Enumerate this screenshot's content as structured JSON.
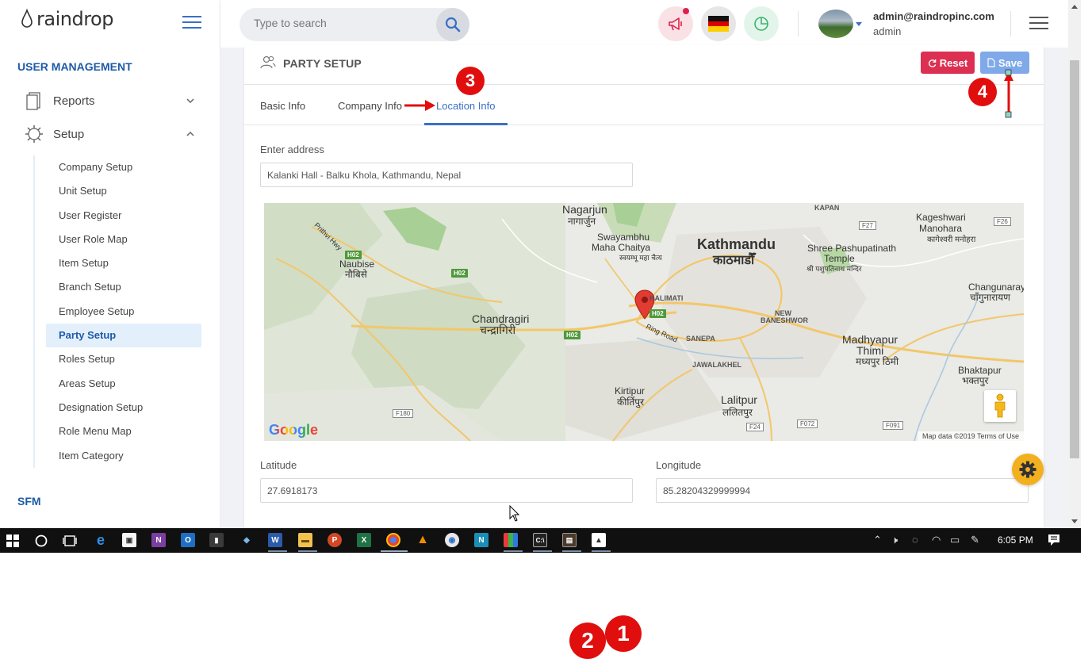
{
  "brand": {
    "name": "raindrop"
  },
  "sidebar": {
    "section_user_management": "USER MANAGEMENT",
    "section_sfm": "SFM",
    "groups": [
      {
        "label": "Reports",
        "expanded": false
      },
      {
        "label": "Setup",
        "expanded": true
      }
    ],
    "setup_items": [
      "Company Setup",
      "Unit Setup",
      "User Register",
      "User Role Map",
      "Item Setup",
      "Branch Setup",
      "Employee Setup",
      "Party Setup",
      "Roles Setup",
      "Areas Setup",
      "Designation Setup",
      "Role Menu Map",
      "Item Category"
    ],
    "active_item": "Party Setup"
  },
  "header": {
    "search_placeholder": "Type to search",
    "user_email": "admin@raindropinc.com",
    "user_role": "admin"
  },
  "page": {
    "title": "PARTY SETUP",
    "reset_label": "Reset",
    "save_label": "Save",
    "tabs": [
      "Basic Info",
      "Company Info",
      "Location Info"
    ],
    "active_tab": "Location Info",
    "address_label": "Enter address",
    "address_value": "Kalanki Hall - Balku Khola, Kathmandu, Nepal",
    "latitude_label": "Latitude",
    "latitude_value": "27.6918173",
    "longitude_label": "Longitude",
    "longitude_value": "85.28204329999994"
  },
  "map": {
    "places": {
      "nagarjun": "Nagarjun",
      "nagarjun_ne": "नागार्जुन",
      "swayambhu": "Swayambhu",
      "maha_chaitya": "Maha Chaitya",
      "swayambhu_ne": "स्वयम्भू महा चैत्य",
      "kathmandu": "Kathmandu",
      "kathmandu_ne": "काठमाडौँ",
      "pashupatinath": "Shree Pashupatinath",
      "temple": "Temple",
      "pashupatinath_ne": "श्री पशुपतिनाथ मन्दिर",
      "kageshwari": "Kageshwari",
      "manohara": "Manohara",
      "kageshwari_ne": "कागेश्वरी मनोहरा",
      "naubise": "Naubise",
      "naubise_ne": "नौबिसे",
      "prithvi_hwy": "Prithvi Hwy",
      "changunarayan": "Changunarayan",
      "changunarayan_ne": "चाँगुनारायण",
      "chandragiri": "Chandragiri",
      "chandragiri_ne": "चन्द्रागिरी",
      "kalimati": "KALIMATI",
      "new_baneshwor": "NEW",
      "baneshwor": "BANESHWOR",
      "ring_road": "Ring Road",
      "sanepa": "SANEPA",
      "jawalakhel": "JAWALAKHEL",
      "madhyapur": "Madhyapur",
      "thimi": "Thimi",
      "madhyapur_ne": "मध्यपुर ठिमी",
      "bhaktapur": "Bhaktapur",
      "bhaktapur_ne": "भक्तपुर",
      "kirtipur": "Kirtipur",
      "kirtipur_ne": "कीर्तिपुर",
      "lalitpur": "Lalitpur",
      "lalitpur_ne": "ललितपुर",
      "kapan": "KAPAN"
    },
    "highways": [
      "H02",
      "H02",
      "H02",
      "H02"
    ],
    "roads": [
      "F26",
      "F27",
      "F180",
      "F24",
      "F072",
      "F091"
    ],
    "logo": "Google",
    "attribution": "Map data ©2019   Terms of Use"
  },
  "taskbar": {
    "time": "6:05 PM"
  },
  "annotations": [
    "1",
    "2",
    "3",
    "4"
  ],
  "colors": {
    "accent": "#3b6fc4",
    "reset": "#dc2f52",
    "save": "#7fa9e8",
    "annotation": "#e10e0e",
    "fab": "#f2b01e"
  }
}
